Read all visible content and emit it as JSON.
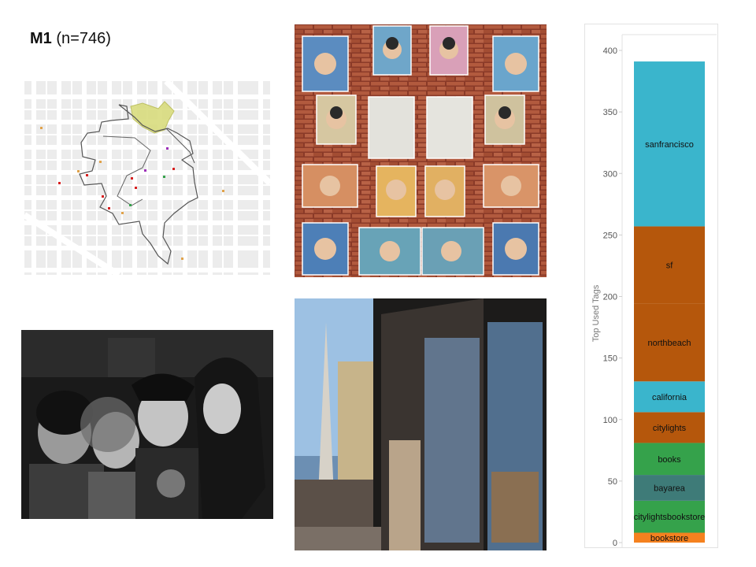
{
  "heading": {
    "bold": "M1",
    "rest": "(n=746)"
  },
  "chart_data": {
    "type": "bar",
    "stacked": true,
    "ylabel": "Top Used Tags",
    "ylim": [
      0,
      400
    ],
    "yticks": [
      0,
      50,
      100,
      150,
      200,
      250,
      300,
      350,
      400
    ],
    "segments": [
      {
        "name": "bookstore",
        "start": 0,
        "end": 8,
        "color": "#f5811f"
      },
      {
        "name": "citylightsbookstore",
        "start": 8,
        "end": 34,
        "color": "#35a24b"
      },
      {
        "name": "bayarea",
        "start": 34,
        "end": 55,
        "color": "#3e7b78"
      },
      {
        "name": "books",
        "start": 55,
        "end": 81,
        "color": "#35a24b"
      },
      {
        "name": "citylights",
        "start": 81,
        "end": 106,
        "color": "#b5570c"
      },
      {
        "name": "california",
        "start": 106,
        "end": 131,
        "color": "#3ab5cc"
      },
      {
        "name": "northbeach",
        "start": 131,
        "end": 194,
        "color": "#b5570c"
      },
      {
        "name": "sf",
        "start": 194,
        "end": 257,
        "color": "#b5570c"
      },
      {
        "name": "sanfrancisco",
        "start": 257,
        "end": 391,
        "color": "#3ab5cc"
      }
    ]
  },
  "map": {
    "street_color": "#ffffff",
    "block_color": "#d9d9d9",
    "highlight_color": "#d9dc7e",
    "route_color": "#555555"
  }
}
